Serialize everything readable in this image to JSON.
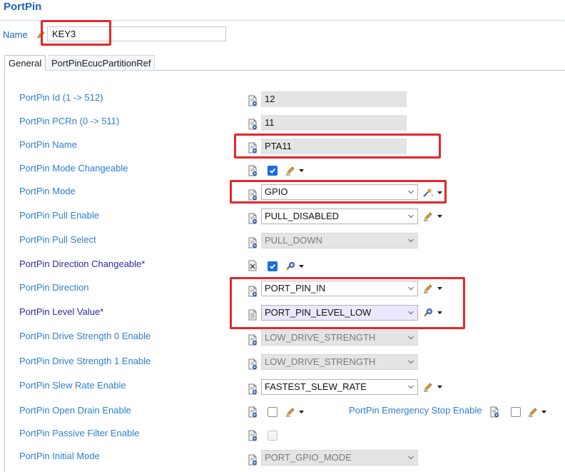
{
  "header": {
    "title": "PortPin"
  },
  "name_field": {
    "label": "Name",
    "value": "KEY3"
  },
  "tabs": [
    {
      "label": "General",
      "active": true
    },
    {
      "label": "PortPinEcucPartitionRef",
      "active": false
    }
  ],
  "fields": {
    "id": {
      "label": "PortPin Id (1 -> 512)",
      "value": "12"
    },
    "pcrn": {
      "label": "PortPin PCRn (0 -> 511)",
      "value": "11"
    },
    "name": {
      "label": "PortPin Name",
      "value": "PTA11"
    },
    "mode_changeable": {
      "label": "PortPin Mode Changeable",
      "checked": true
    },
    "mode": {
      "label": "PortPin Mode",
      "value": "GPIO"
    },
    "pull_enable": {
      "label": "PortPin Pull Enable",
      "value": "PULL_DISABLED"
    },
    "pull_select": {
      "label": "PortPin Pull Select",
      "value": "PULL_DOWN"
    },
    "direction_changeable": {
      "label": "PortPin Direction Changeable*",
      "checked": true
    },
    "direction": {
      "label": "PortPin Direction",
      "value": "PORT_PIN_IN"
    },
    "level_value": {
      "label": "PortPin Level Value*",
      "value": "PORT_PIN_LEVEL_LOW"
    },
    "drive0": {
      "label": "PortPin Drive Strength 0 Enable",
      "value": "LOW_DRIVE_STRENGTH"
    },
    "drive1": {
      "label": "PortPin Drive Strength 1 Enable",
      "value": "LOW_DRIVE_STRENGTH"
    },
    "slew": {
      "label": "PortPin Slew Rate Enable",
      "value": "FASTEST_SLEW_RATE"
    },
    "open_drain": {
      "label": "PortPin Open Drain Enable",
      "checked": false
    },
    "emergency_stop": {
      "label": "PortPin Emergency Stop Enable",
      "checked": false
    },
    "passive_filter": {
      "label": "PortPin Passive Filter Enable",
      "checked": false
    },
    "initial_mode": {
      "label": "PortPin Initial Mode",
      "value": "PORT_GPIO_MODE"
    }
  },
  "colors": {
    "title": "#1f63b8",
    "label": "#2b7fd0",
    "label_required": "#2a2aa8",
    "checkbox_on": "#1a6fd6",
    "highlight_box": "#e5262b",
    "highlight_field": "#eae8ff"
  }
}
